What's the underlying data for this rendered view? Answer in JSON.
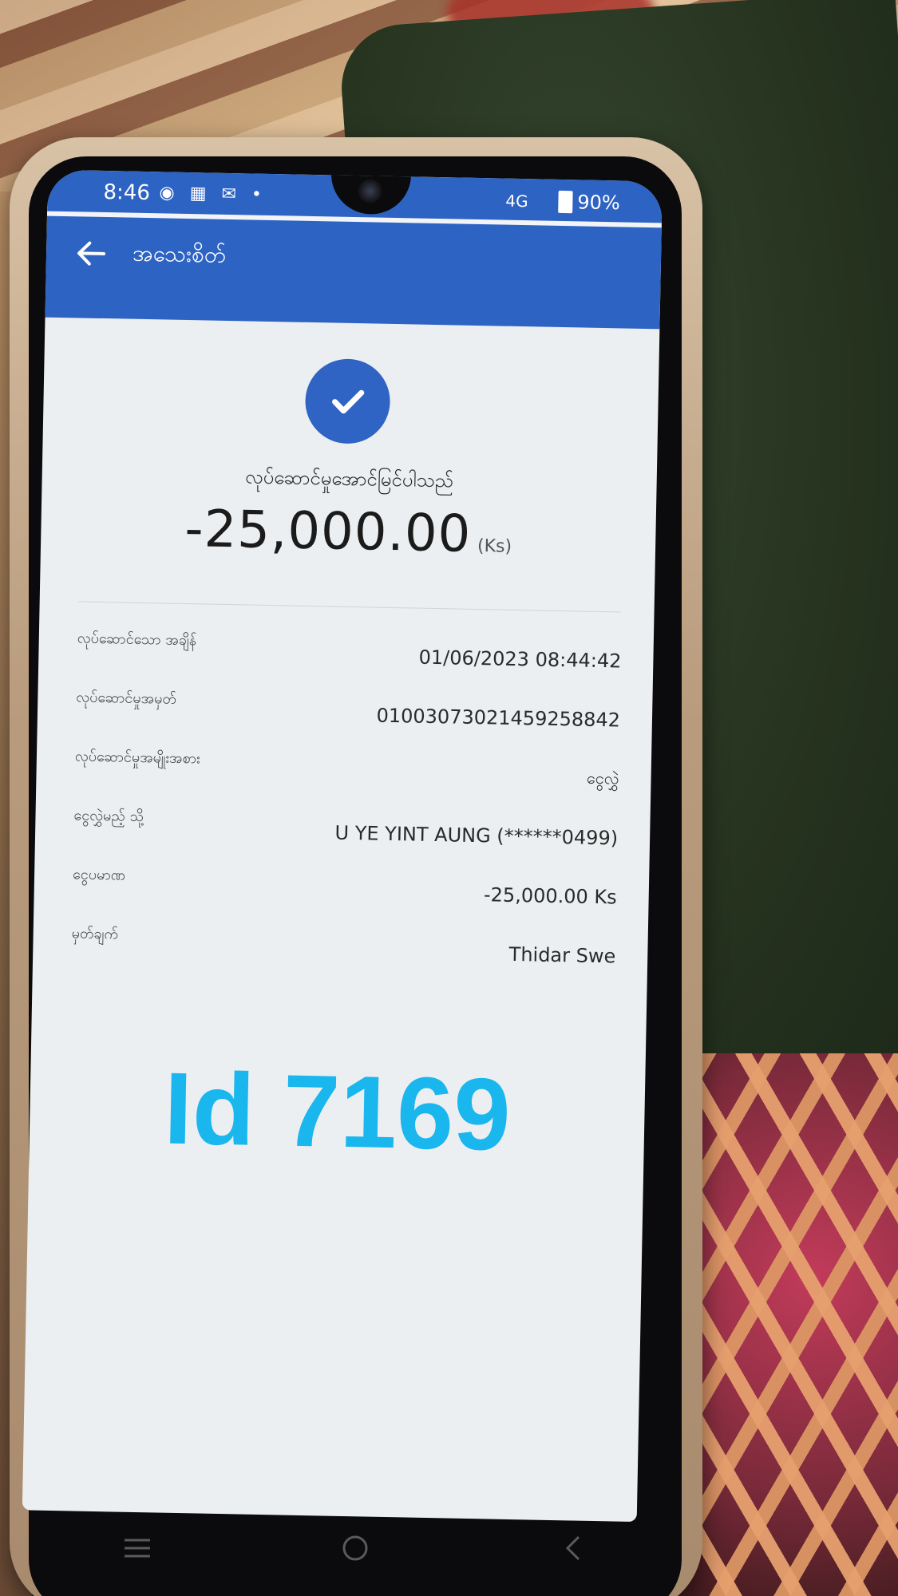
{
  "status_bar": {
    "time": "8:46",
    "left_icons": "◉ ▦ ✉ •",
    "network": "4G",
    "battery": "90%"
  },
  "app_bar": {
    "title": "အသေးစိတ်",
    "back_icon": "arrow-left-icon"
  },
  "result": {
    "icon": "check-icon",
    "message": "လုပ်ဆောင်မှုအောင်မြင်ပါသည်",
    "amount": "-25,000.00",
    "currency": "(Ks)"
  },
  "details": [
    {
      "label": "လုပ်ဆောင်သော အချိန်",
      "value": "01/06/2023 08:44:42"
    },
    {
      "label": "လုပ်ဆောင်မှုအမှတ်",
      "value": "01003073021459258842"
    },
    {
      "label": "လုပ်ဆောင်မှုအမျိုးအစား",
      "value": "ငွေလွှဲ"
    },
    {
      "label": "ငွေလွှဲမည့် သို့",
      "value": "U YE YINT AUNG (******0499)"
    },
    {
      "label": "ငွေပမာဏ",
      "value": "-25,000.00 Ks"
    },
    {
      "label": "မှတ်ချက်",
      "value": "Thidar Swe"
    }
  ],
  "overlay_text": "Id 7169",
  "colors": {
    "primary": "#2d63c3",
    "watermark": "#1ab6ee",
    "background": "#eceff1"
  },
  "nav": [
    "menu-icon",
    "home-icon",
    "back-icon"
  ]
}
